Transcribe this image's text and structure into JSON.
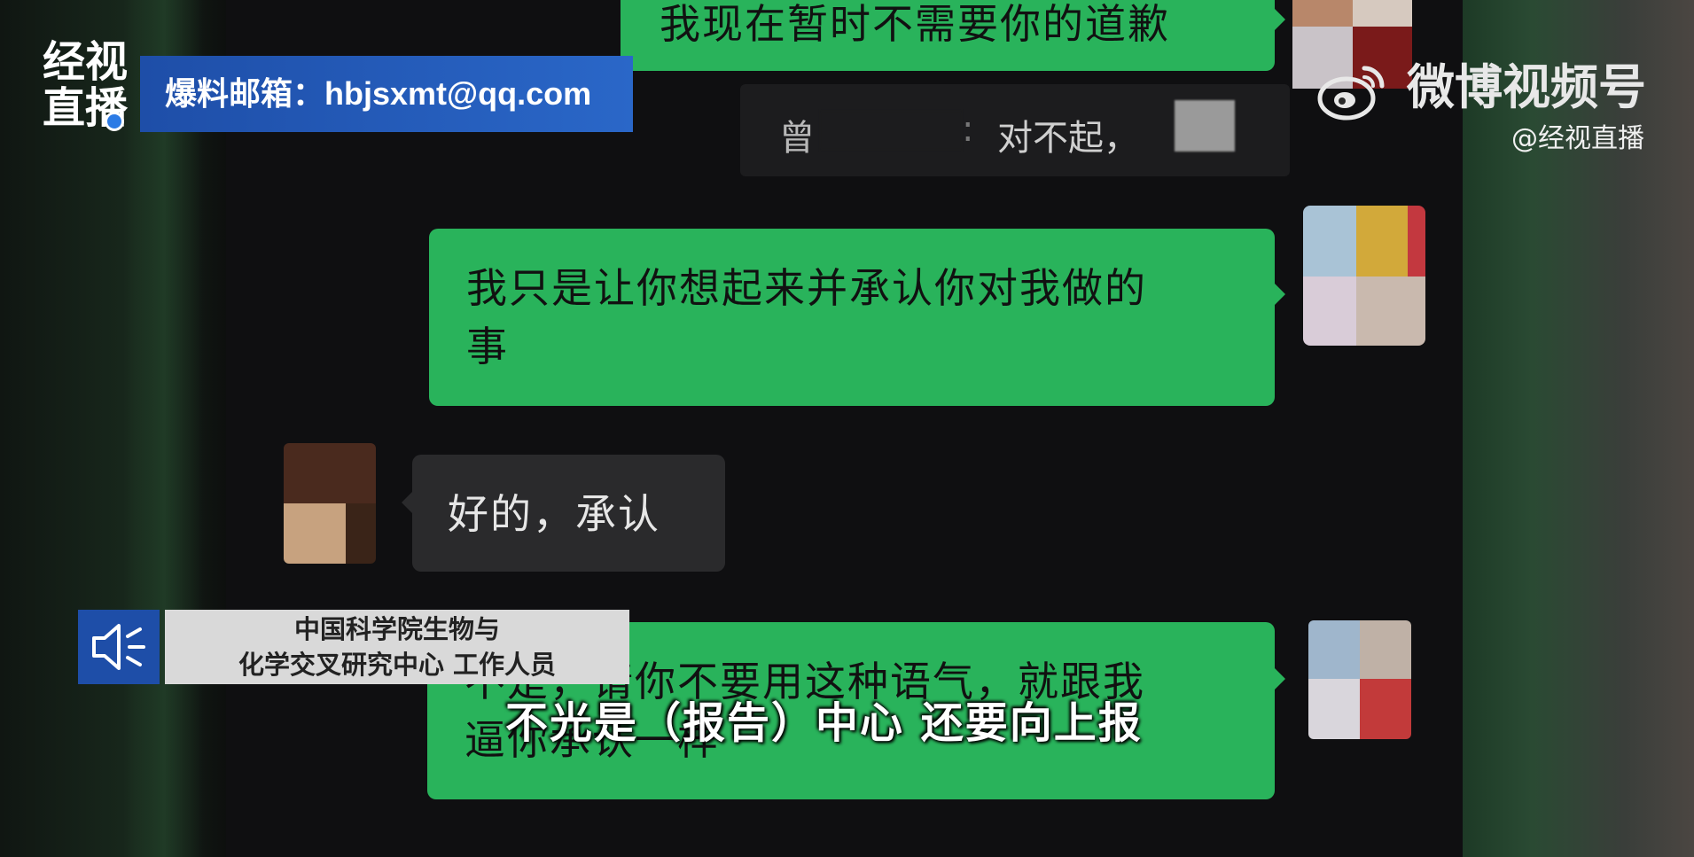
{
  "channel": {
    "logo_line1": "经视",
    "logo_line2": "直播",
    "tip_label": "爆料邮箱：hbjsxmt@qq.com"
  },
  "watermark": {
    "name": "微博视频号",
    "handle": "@经视直播"
  },
  "messages": [
    {
      "side": "right",
      "text_line1": "我现在暂时不需要你的道歉",
      "text_line2": ""
    },
    {
      "side": "quote",
      "prefix": "曾",
      "text": "对不起，"
    },
    {
      "side": "right",
      "text_line1": "我只是让你想起来并承认你对我做的",
      "text_line2": "事"
    },
    {
      "side": "left",
      "text_line1": "好的，承认",
      "text_line2": ""
    },
    {
      "side": "right",
      "text_line1": "不是，请你不要用这种语气，就跟我",
      "text_line2": "逼你承认一样"
    }
  ],
  "speaker_plate": {
    "line1": "中国科学院生物与",
    "line2": "化学交叉研究中心  工作人员"
  },
  "subtitle": "不光是（报告）中心 还要向上报",
  "colors": {
    "bubble_green": "#29b35b",
    "bubble_gray": "#2a2a2c",
    "brand_blue": "#1e4ea8"
  },
  "icons": [
    "weibo-icon",
    "speaker-icon"
  ]
}
